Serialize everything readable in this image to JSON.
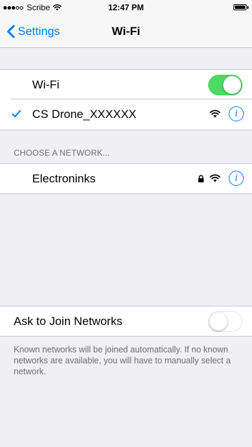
{
  "status_bar": {
    "carrier": "Scribe",
    "time": "12:47 PM",
    "signal_filled": 3,
    "signal_total": 5,
    "battery": "full"
  },
  "nav": {
    "back_label": "Settings",
    "title": "Wi-Fi"
  },
  "wifi_group": {
    "toggle_label": "Wi-Fi",
    "toggle_on": true,
    "connected_network": "CS Drone_XXXXXX"
  },
  "choose_section": {
    "header": "CHOOSE A NETWORK...",
    "networks": [
      {
        "name": "Electroninks",
        "locked": true
      }
    ]
  },
  "ask_join": {
    "label": "Ask to Join Networks",
    "toggle_on": false,
    "footer": "Known networks will be joined automatically. If no known networks are available, you will have to manually select a network."
  },
  "colors": {
    "accent": "#007aff",
    "toggle_on": "#4cd964",
    "background": "#efeff4"
  }
}
